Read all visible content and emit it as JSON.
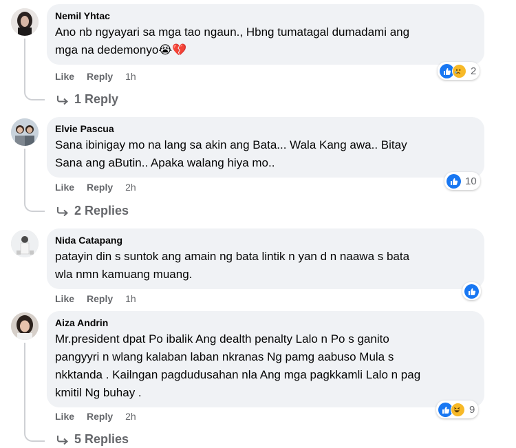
{
  "comments": [
    {
      "author": "Nemil Yhtac",
      "line1": "Ano nb ngyayari sa mga tao ngaun., Hbng tumatagal dumadami ang",
      "line2": "mga na dedemonyo😭💔",
      "like": "Like",
      "reply": "Reply",
      "time": "1h",
      "reaction_count": "2",
      "replies": "1 Reply"
    },
    {
      "author": "Elvie Pascua",
      "line1": "Sana ibinigay mo na lang sa akin ang Bata... Wala Kang awa.. Bitay",
      "line2": "Sana ang aButin.. Apaka walang hiya mo..",
      "like": "Like",
      "reply": "Reply",
      "time": "2h",
      "reaction_count": "10",
      "replies": "2 Replies"
    },
    {
      "author": "Nida Catapang",
      "line1": "patayin din s suntok ang amain ng bata lintik n yan d n naawa s bata",
      "line2": "wla nmn kamuang muang.",
      "like": "Like",
      "reply": "Reply",
      "time": "1h"
    },
    {
      "author": "Aiza Andrin",
      "line1": "Mr.president dpat Po ibalik Ang dealth penalty Lalo n Po s ganito",
      "line2": "pangyyri n wlang kalaban laban nkranas Ng pamg aabuso Mula s",
      "line3": "nkktanda . Kailngan pagdudusahan nla Ang mga pagkkamli Lalo n pag",
      "line4": "kmitil Ng buhay .",
      "like": "Like",
      "reply": "Reply",
      "time": "2h",
      "reaction_count": "9",
      "replies": "5 Replies"
    }
  ],
  "icons": {
    "like": "thumbs-up-reaction-icon",
    "sad": "sad-reaction-icon",
    "haha": "haha-reaction-icon",
    "reply_arrow": "reply-arrow-icon"
  },
  "colors": {
    "bubble": "#f0f2f5",
    "like_blue": "#1877f2",
    "emoji_yellow": "#f7b928",
    "muted_text": "#65676b"
  }
}
